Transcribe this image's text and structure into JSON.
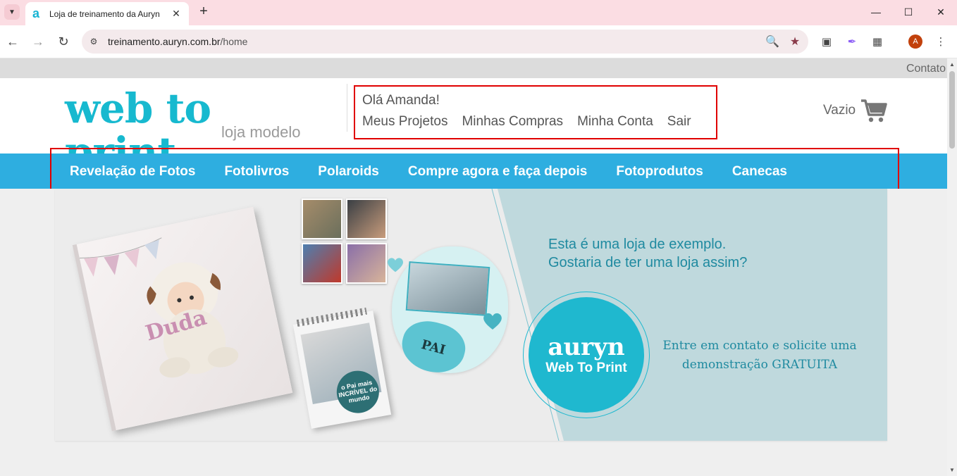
{
  "browser": {
    "tab_title": "Loja de treinamento da Auryn",
    "url_domain": "treinamento.auryn.com.br",
    "url_path": "/home",
    "avatar_letter": "A"
  },
  "site": {
    "top_link": "Contato",
    "logo_main": "web to print",
    "logo_sub": "loja modelo",
    "greeting": "Olá Amanda!",
    "user_links": [
      "Meus Projetos",
      "Minhas Compras",
      "Minha Conta",
      "Sair"
    ],
    "cart_label": "Vazio",
    "nav": [
      "Revelação de Fotos",
      "Fotolivros",
      "Polaroids",
      "Compre agora e faça depois",
      "Fotoprodutos",
      "Canecas"
    ]
  },
  "banner": {
    "line1": "Esta é uma loja de exemplo.",
    "line2": "Gostaria de ter uma loja assim?",
    "brand_name": "auryn",
    "brand_sub": "Web To Print",
    "demo_line1": "Entre em contato e solicite uma",
    "demo_line2": "demonstração GRATUITA",
    "book_name": "Duda",
    "magnet_text": "PAI",
    "calendar_text": "o Pai mais INCRÍVEL do mundo"
  },
  "colors": {
    "brand_cyan": "#17b9cf",
    "nav_blue": "#2eaee0",
    "highlight_red": "#e00000",
    "tab_bar_pink": "#fbdde3"
  }
}
